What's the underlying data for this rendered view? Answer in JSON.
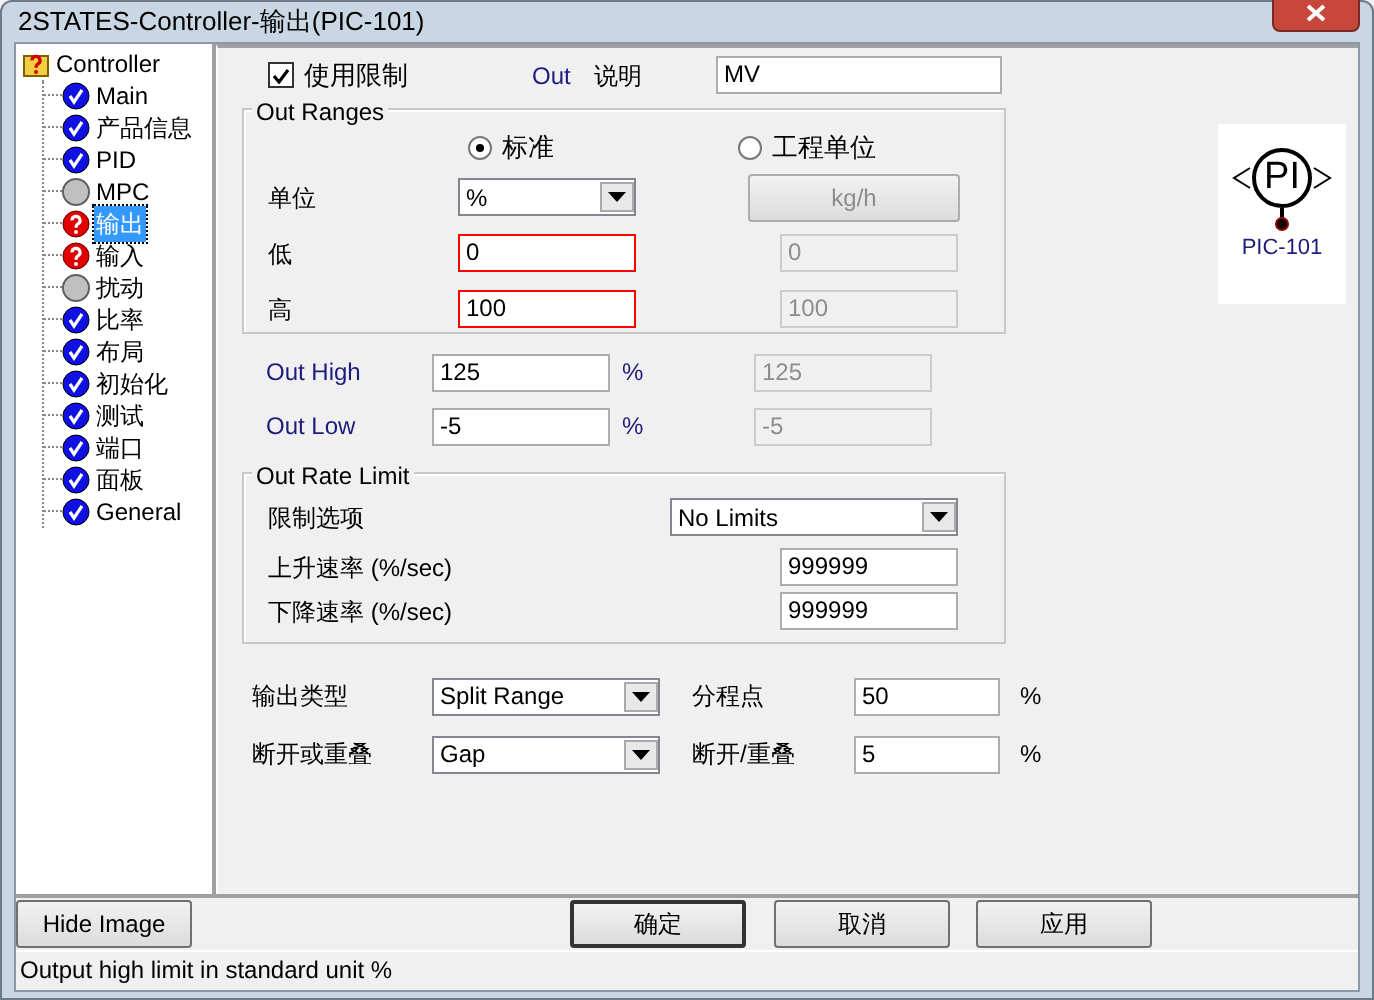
{
  "window": {
    "title": "2STATES-Controller-输出(PIC-101)"
  },
  "tree": {
    "label": "Controller",
    "kind": "folder",
    "selected": false,
    "children": [
      {
        "label": "Main",
        "kind": "ok",
        "selected": false
      },
      {
        "label": "产品信息",
        "kind": "ok",
        "selected": false
      },
      {
        "label": "PID",
        "kind": "ok",
        "selected": false
      },
      {
        "label": "MPC",
        "kind": "none",
        "selected": false
      },
      {
        "label": "输出",
        "kind": "error",
        "selected": true
      },
      {
        "label": "输入",
        "kind": "error",
        "selected": false
      },
      {
        "label": "扰动",
        "kind": "none",
        "selected": false
      },
      {
        "label": "比率",
        "kind": "ok",
        "selected": false
      },
      {
        "label": "布局",
        "kind": "ok",
        "selected": false
      },
      {
        "label": "初始化",
        "kind": "ok",
        "selected": false
      },
      {
        "label": "测试",
        "kind": "ok",
        "selected": false
      },
      {
        "label": "端口",
        "kind": "ok",
        "selected": false
      },
      {
        "label": "面板",
        "kind": "ok",
        "selected": false
      },
      {
        "label": "General",
        "kind": "ok",
        "selected": false
      }
    ]
  },
  "use_limit": {
    "label": "使用限制",
    "checked": true
  },
  "out_label": "Out",
  "description": {
    "label": "说明",
    "value": "MV"
  },
  "out_ranges": {
    "title": "Out Ranges",
    "radios": [
      {
        "label": "标准",
        "selected": true
      },
      {
        "label": "工程单位",
        "selected": false
      }
    ],
    "unit": {
      "label": "单位",
      "value": "%",
      "eng_button": "kg/h",
      "eng_disabled": true
    },
    "rows": [
      {
        "label": "低",
        "value": "0",
        "invalid": true,
        "eng_value": "0"
      },
      {
        "label": "高",
        "value": "100",
        "invalid": true,
        "eng_value": "100"
      }
    ]
  },
  "limits": [
    {
      "label": "Out High",
      "value": "125",
      "unit": "%",
      "eng_value": "125"
    },
    {
      "label": "Out Low",
      "value": "-5",
      "unit": "%",
      "eng_value": "-5"
    }
  ],
  "rate_limit": {
    "title": "Out Rate Limit",
    "option": {
      "label": "限制选项",
      "value": "No Limits"
    },
    "rates": [
      {
        "label": "上升速率 (%/sec)",
        "value": "999999"
      },
      {
        "label": "下降速率 (%/sec)",
        "value": "999999"
      }
    ]
  },
  "output": [
    {
      "label": "输出类型",
      "select": "Split Range",
      "field_label": "分程点",
      "field_value": "50",
      "unit": "%"
    },
    {
      "label": "断开或重叠",
      "select": "Gap",
      "field_label": "断开/重叠",
      "field_value": "5",
      "unit": "%"
    }
  ],
  "image": {
    "symbol": "PI",
    "tag": "PIC-101"
  },
  "buttons": [
    {
      "label": "Hide Image",
      "default": false
    },
    {
      "label": "确定",
      "default": true
    },
    {
      "label": "取消",
      "default": false
    },
    {
      "label": "应用",
      "default": false
    }
  ],
  "status_bar": "Output high limit in standard unit %"
}
